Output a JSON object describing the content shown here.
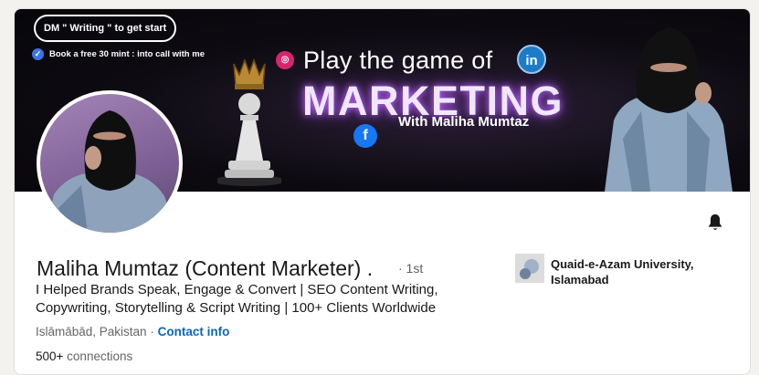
{
  "banner": {
    "dm_pill": "DM \" Writing \" to get start",
    "book_call": "Book a free 30 mint : into call with me",
    "headline_line1": "Play the game of",
    "headline_line2": "MARKETING",
    "headline_line3": "With Maliha Mumtaz"
  },
  "profile": {
    "name": "Maliha Mumtaz (Content Marketer) .",
    "degree": "· 1st",
    "headline": "I Helped Brands Speak, Engage & Convert | SEO Content Writing, Copywriting, Storytelling & Script Writing | 100+ Clients Worldwide",
    "location": "Islāmābād, Pakistan",
    "location_separator": " · ",
    "contact_info": "Contact info",
    "connections_count": "500+",
    "connections_label": " connections"
  },
  "education": {
    "school": "Quaid-e-Azam University, Islamabad"
  },
  "colors": {
    "link": "#0a66c2",
    "banner_glow": "#c06cff"
  }
}
